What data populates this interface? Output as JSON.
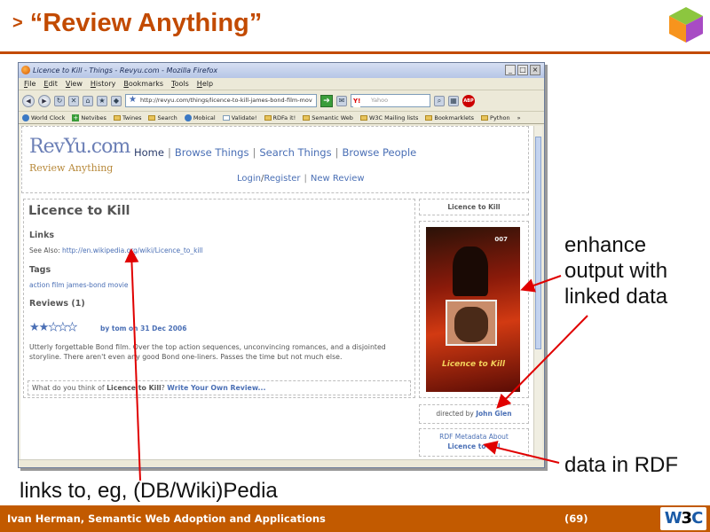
{
  "slide": {
    "arrow": ">",
    "title": "“Review Anything”",
    "footer_author": "Ivan Herman, Semantic Web Adoption and Applications",
    "page_number": "(69)",
    "w3c_w": "W",
    "w3c_3": "3",
    "w3c_c": "C",
    "accent_color": "#c24a00"
  },
  "browser": {
    "window_title": "Licence to Kill - Things - Revyu.com - Mozilla Firefox",
    "window_buttons": [
      "_",
      "□",
      "×"
    ],
    "menu": [
      "File",
      "Edit",
      "View",
      "History",
      "Bookmarks",
      "Tools",
      "Help"
    ],
    "url": "http://revyu.com/things/licence-to-kill-james-bond-film-mov",
    "search_engine": "Y!",
    "search_placeholder": "Yahoo",
    "adblock_label": "ABP",
    "bookmarks": [
      "World Clock",
      "Netvibes",
      "Twines",
      "Search",
      "Mobical",
      "Validate!",
      "RDFa it!",
      "Semantic Web",
      "W3C Mailing lists",
      "Bookmarklets",
      "Python"
    ],
    "bookmarks_overflow": "»"
  },
  "site": {
    "logo_main": "RevYu.com",
    "logo_sub": "Review Anything",
    "nav": {
      "home": "Home",
      "browse_things": "Browse Things",
      "search_things": "Search Things",
      "browse_people": "Browse People",
      "sep": "|"
    },
    "subnav": {
      "login": "Login",
      "slash": "/",
      "register": "Register",
      "sep": "|",
      "new_review": "New Review"
    }
  },
  "thing": {
    "title": "Licence to Kill",
    "links_heading": "Links",
    "see_also_label": "See Also:",
    "see_also_url": "http://en.wikipedia.org/wiki/Licence_to_kill",
    "tags_heading": "Tags",
    "tags": "action film james-bond movie",
    "reviews_heading": "Reviews (1)",
    "rating": 2,
    "rating_max": 5,
    "review_byline": "by tom on 31 Dec 2006",
    "review_text": "Utterly forgettable Bond film. Over the top action sequences, unconvincing romances, and a disjointed storyline. There aren't even any good Bond one-liners. Passes the time but not much else.",
    "prompt_prefix": "What do you think of",
    "prompt_thing": "Licence to Kill",
    "prompt_q": "?",
    "prompt_link": "Write Your Own Review..."
  },
  "sidebar": {
    "title": "Licence to Kill",
    "poster_tag": "007",
    "poster_title": "Licence to Kill",
    "directed_by_label": "directed by",
    "director": "John Glen",
    "rdf_line1": "RDF Metadata About",
    "rdf_line2": "Licence to Kill"
  },
  "annotations": {
    "enhance_line1": "enhance",
    "enhance_line2": "output with",
    "enhance_line3": "linked data",
    "rdf": "data in RDF",
    "links": "links to, eg, (DB/Wiki)Pedia",
    "arrow_color": "#e00000"
  }
}
